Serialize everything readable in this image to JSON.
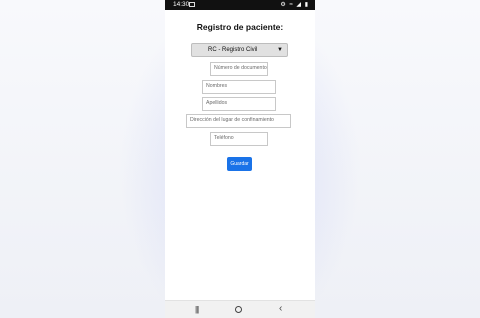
{
  "status": {
    "time": "14:30",
    "icons": "⚙ ≈ ◢ ▮"
  },
  "form": {
    "title": "Registro de paciente:",
    "doc_type": "RC - Registro Civil",
    "fields": {
      "doc_number": "Número de documento",
      "first_names": "Nombres",
      "last_names": "Apellidos",
      "address": "Dirección del lugar de confinamiento",
      "phone": "Teléfono"
    },
    "save_label": "Guardar"
  },
  "colors": {
    "accent": "#1a73e8",
    "select_bg": "#e1e1e1"
  },
  "nav": {
    "recent": "|||",
    "back": "‹"
  }
}
